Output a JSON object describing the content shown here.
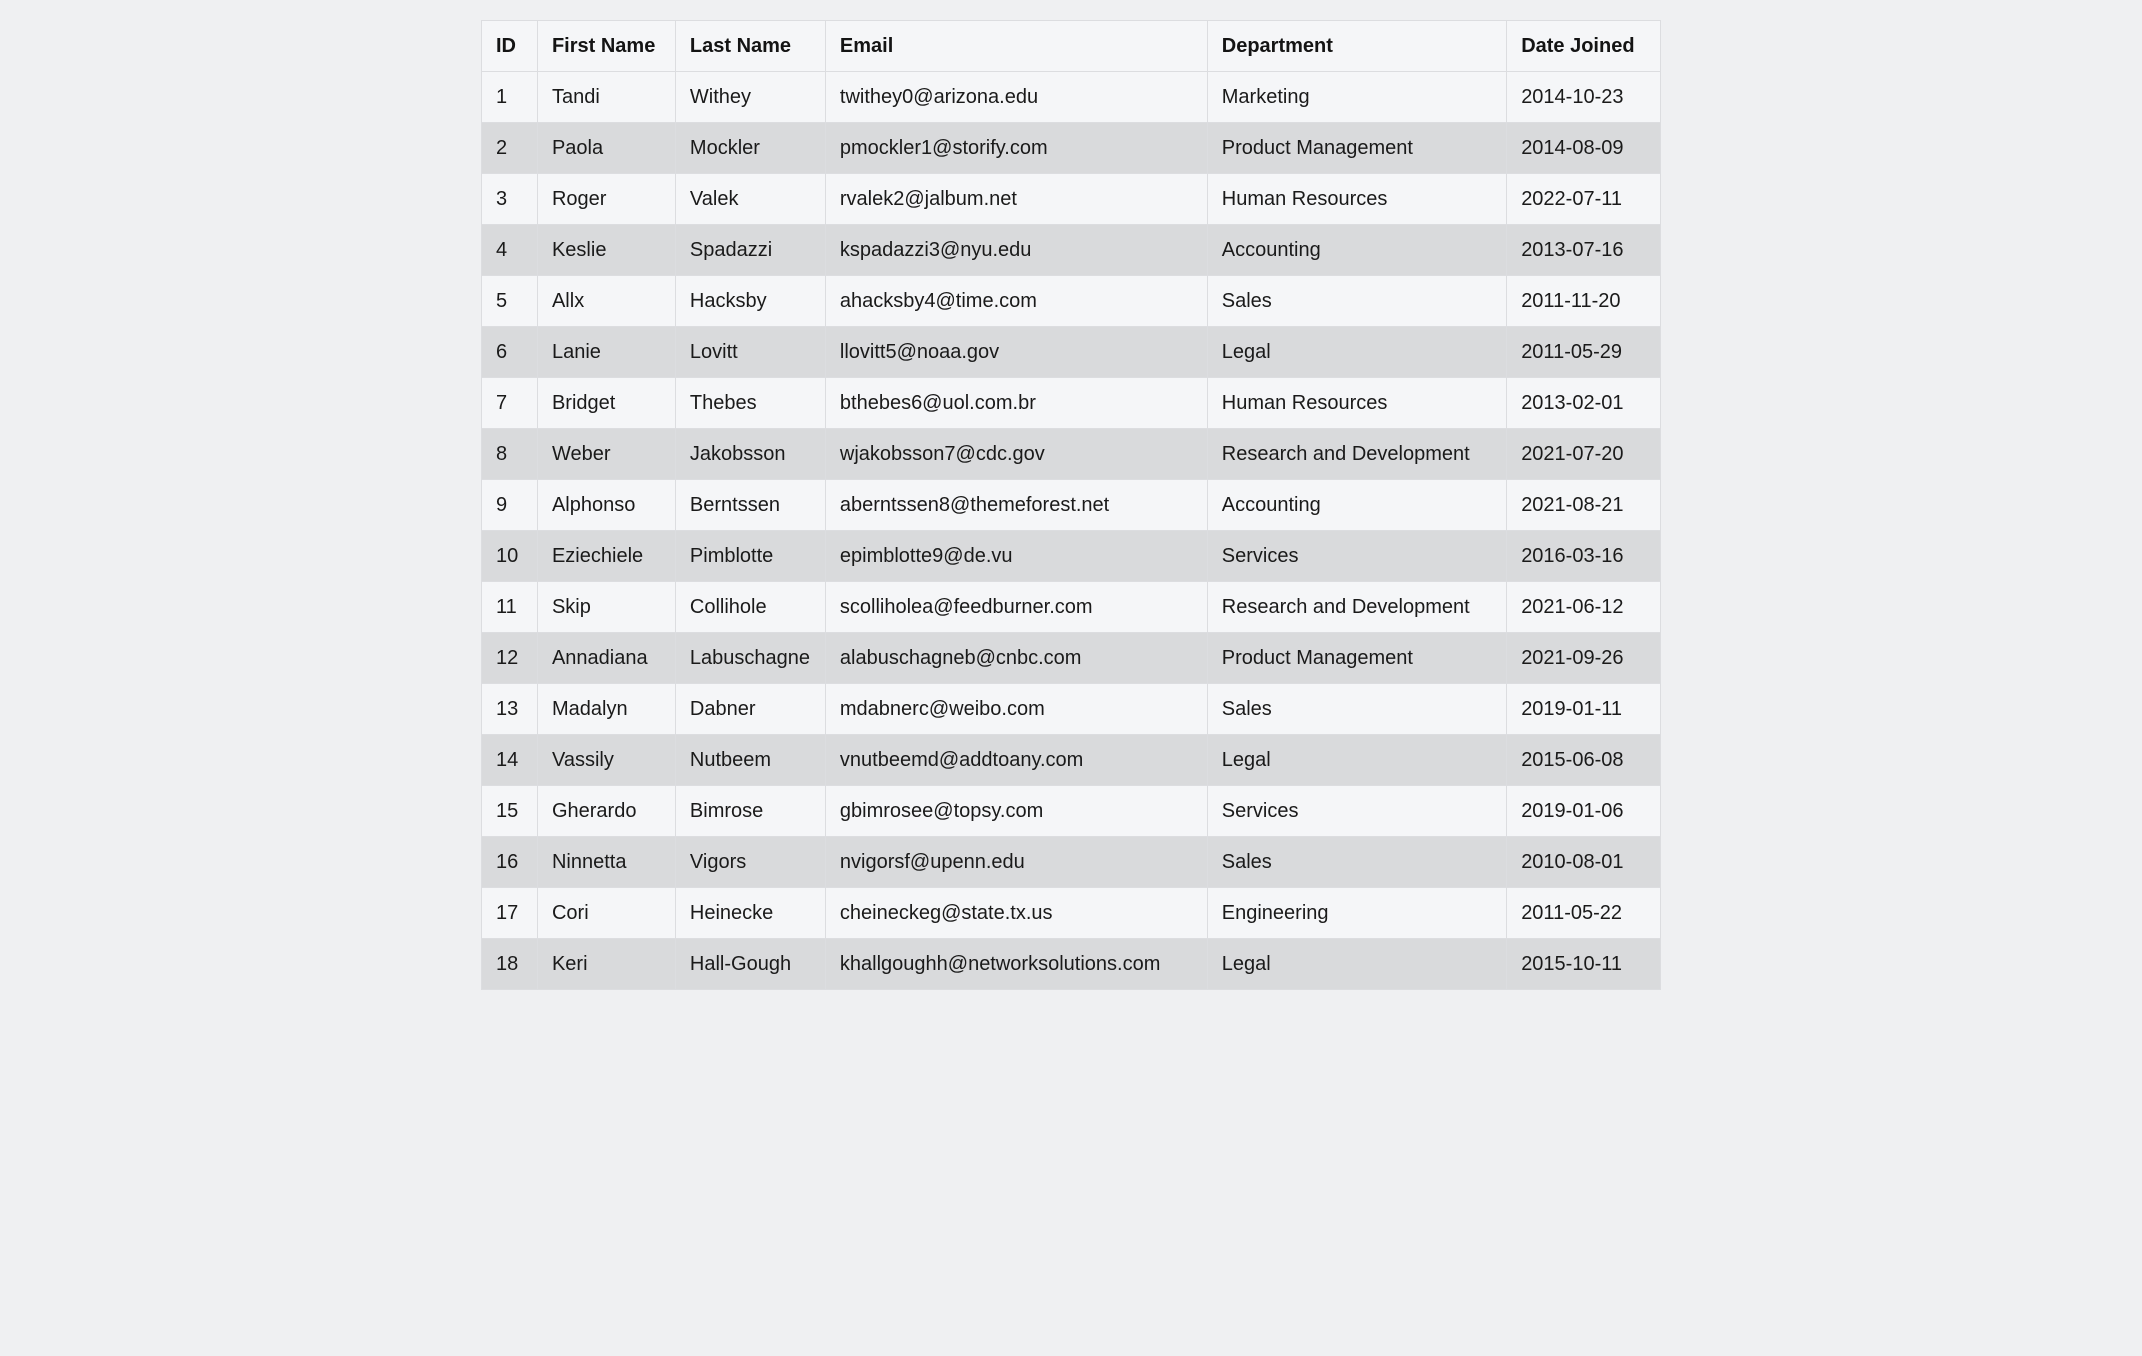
{
  "table": {
    "headers": {
      "id": "ID",
      "first_name": "First Name",
      "last_name": "Last Name",
      "email": "Email",
      "department": "Department",
      "date_joined": "Date Joined"
    },
    "rows": [
      {
        "id": "1",
        "first_name": "Tandi",
        "last_name": "Withey",
        "email": "twithey0@arizona.edu",
        "department": "Marketing",
        "date_joined": "2014-10-23"
      },
      {
        "id": "2",
        "first_name": "Paola",
        "last_name": "Mockler",
        "email": "pmockler1@storify.com",
        "department": "Product Management",
        "date_joined": "2014-08-09"
      },
      {
        "id": "3",
        "first_name": "Roger",
        "last_name": "Valek",
        "email": "rvalek2@jalbum.net",
        "department": "Human Resources",
        "date_joined": "2022-07-11"
      },
      {
        "id": "4",
        "first_name": "Keslie",
        "last_name": "Spadazzi",
        "email": "kspadazzi3@nyu.edu",
        "department": "Accounting",
        "date_joined": "2013-07-16"
      },
      {
        "id": "5",
        "first_name": "Allx",
        "last_name": "Hacksby",
        "email": "ahacksby4@time.com",
        "department": "Sales",
        "date_joined": "2011-11-20"
      },
      {
        "id": "6",
        "first_name": "Lanie",
        "last_name": "Lovitt",
        "email": "llovitt5@noaa.gov",
        "department": "Legal",
        "date_joined": "2011-05-29"
      },
      {
        "id": "7",
        "first_name": "Bridget",
        "last_name": "Thebes",
        "email": "bthebes6@uol.com.br",
        "department": "Human Resources",
        "date_joined": "2013-02-01"
      },
      {
        "id": "8",
        "first_name": "Weber",
        "last_name": "Jakobsson",
        "email": "wjakobsson7@cdc.gov",
        "department": "Research and Development",
        "date_joined": "2021-07-20"
      },
      {
        "id": "9",
        "first_name": "Alphonso",
        "last_name": "Berntssen",
        "email": "aberntssen8@themeforest.net",
        "department": "Accounting",
        "date_joined": "2021-08-21"
      },
      {
        "id": "10",
        "first_name": "Eziechiele",
        "last_name": "Pimblotte",
        "email": "epimblotte9@de.vu",
        "department": "Services",
        "date_joined": "2016-03-16"
      },
      {
        "id": "11",
        "first_name": "Skip",
        "last_name": "Collihole",
        "email": "scolliholea@feedburner.com",
        "department": "Research and Development",
        "date_joined": "2021-06-12"
      },
      {
        "id": "12",
        "first_name": "Annadiana",
        "last_name": "Labuschagne",
        "email": "alabuschagneb@cnbc.com",
        "department": "Product Management",
        "date_joined": "2021-09-26"
      },
      {
        "id": "13",
        "first_name": "Madalyn",
        "last_name": "Dabner",
        "email": "mdabnerc@weibo.com",
        "department": "Sales",
        "date_joined": "2019-01-11"
      },
      {
        "id": "14",
        "first_name": "Vassily",
        "last_name": "Nutbeem",
        "email": "vnutbeemd@addtoany.com",
        "department": "Legal",
        "date_joined": "2015-06-08"
      },
      {
        "id": "15",
        "first_name": "Gherardo",
        "last_name": "Bimrose",
        "email": "gbimrosee@topsy.com",
        "department": "Services",
        "date_joined": "2019-01-06"
      },
      {
        "id": "16",
        "first_name": "Ninnetta",
        "last_name": "Vigors",
        "email": "nvigorsf@upenn.edu",
        "department": "Sales",
        "date_joined": "2010-08-01"
      },
      {
        "id": "17",
        "first_name": "Cori",
        "last_name": "Heinecke",
        "email": "cheineckeg@state.tx.us",
        "department": "Engineering",
        "date_joined": "2011-05-22"
      },
      {
        "id": "18",
        "first_name": "Keri",
        "last_name": "Hall-Gough",
        "email": "khallgoughh@networksolutions.com",
        "department": "Legal",
        "date_joined": "2015-10-11"
      }
    ]
  }
}
